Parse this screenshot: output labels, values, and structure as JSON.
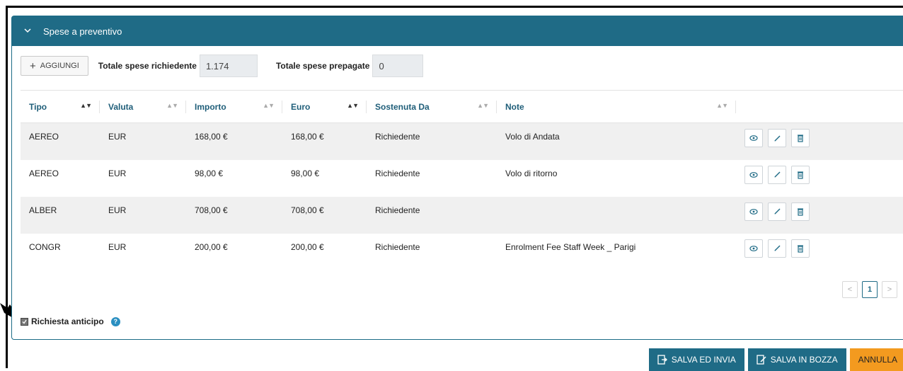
{
  "panel": {
    "title": "Spese a preventivo",
    "add_button": "AGGIUNGI",
    "totale_richiedente_label": "Totale spese richiedente",
    "totale_richiedente_value": "1.174",
    "totale_prepagate_label": "Totale spese prepagate",
    "totale_prepagate_value": "0"
  },
  "table": {
    "headers": [
      "Tipo",
      "Valuta",
      "Importo",
      "Euro",
      "Sostenuta Da",
      "Note"
    ],
    "rows": [
      {
        "tipo": "AEREO",
        "valuta": "EUR",
        "importo": "168,00 €",
        "euro": "168,00 €",
        "sostenuta": "Richiedente",
        "note": "Volo di Andata"
      },
      {
        "tipo": "AEREO",
        "valuta": "EUR",
        "importo": "98,00 €",
        "euro": "98,00 €",
        "sostenuta": "Richiedente",
        "note": "Volo di ritorno"
      },
      {
        "tipo": "ALBER",
        "valuta": "EUR",
        "importo": "708,00 €",
        "euro": "708,00 €",
        "sostenuta": "Richiedente",
        "note": ""
      },
      {
        "tipo": "CONGR",
        "valuta": "EUR",
        "importo": "200,00 €",
        "euro": "200,00 €",
        "sostenuta": "Richiedente",
        "note": "Enrolment Fee Staff Week _ Parigi"
      }
    ],
    "row_actions": [
      "eye-icon",
      "pencil-icon",
      "trash-icon"
    ]
  },
  "pagination": {
    "current": "1",
    "prev": "<",
    "next": ">"
  },
  "anticipo": {
    "label": "Richiesta anticipo",
    "checked": true,
    "help": "?"
  },
  "footer": {
    "salva_invia": "SALVA ED INVIA",
    "salva_bozza": "SALVA IN BOZZA",
    "annulla": "ANNULLA"
  },
  "colors": {
    "header": "#1f6b86",
    "accent_orange": "#f39a1f",
    "row_alt": "#f0f0f0"
  }
}
